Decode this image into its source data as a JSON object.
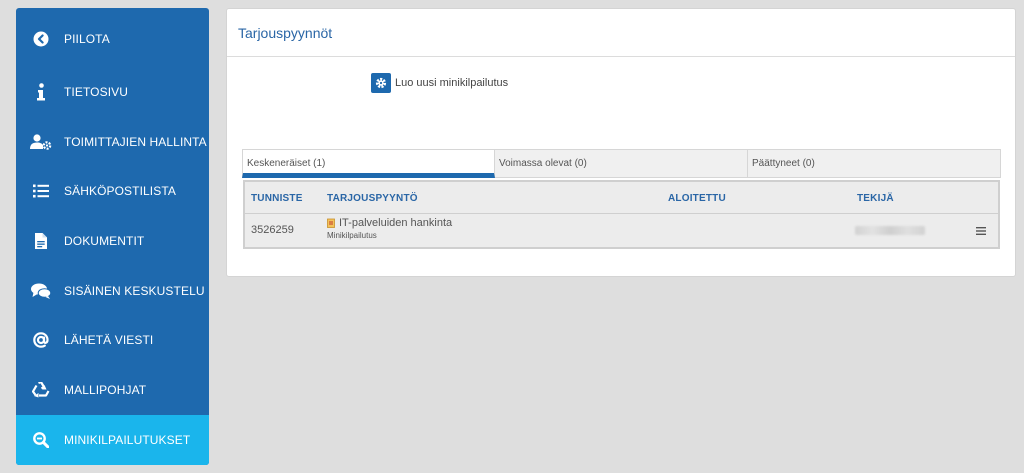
{
  "sidebar": {
    "items": [
      {
        "label": "PIILOTA",
        "icon": "chevron-left-circle-icon"
      },
      {
        "label": "TIETOSIVU",
        "icon": "info-icon"
      },
      {
        "label": "TOIMITTAJIEN HALLINTA",
        "icon": "user-gear-icon"
      },
      {
        "label": "SÄHKÖPOSTILISTA",
        "icon": "list-icon"
      },
      {
        "label": "DOKUMENTIT",
        "icon": "document-icon"
      },
      {
        "label": "SISÄINEN KESKUSTELU",
        "icon": "chat-icon"
      },
      {
        "label": "LÄHETÄ VIESTI",
        "icon": "at-icon"
      },
      {
        "label": "MALLIPOHJAT",
        "icon": "recycle-icon"
      },
      {
        "label": "MINIKILPAILUTUKSET",
        "icon": "search-minus-icon"
      }
    ],
    "active_index": 8
  },
  "panel": {
    "title": "Tarjouspyynnöt",
    "new_button_label": "Luo uusi minikilpailutus",
    "tabs": [
      {
        "label": "Keskeneräiset (1)"
      },
      {
        "label": "Voimassa olevat (0)"
      },
      {
        "label": "Päättyneet (0)"
      }
    ],
    "table": {
      "headers": [
        "TUNNISTE",
        "TARJOUSPYYNTÖ",
        "ALOITETTU",
        "TEKIJÄ"
      ],
      "rows": [
        {
          "id": "3526259",
          "title": "IT-palveluiden hankinta",
          "subtitle": "Minikilpailutus",
          "started": ""
        }
      ]
    }
  },
  "colors": {
    "sidebar_bg": "#1e69ae",
    "sidebar_active": "#1ab5ec",
    "accent_text": "#2a66a6"
  }
}
